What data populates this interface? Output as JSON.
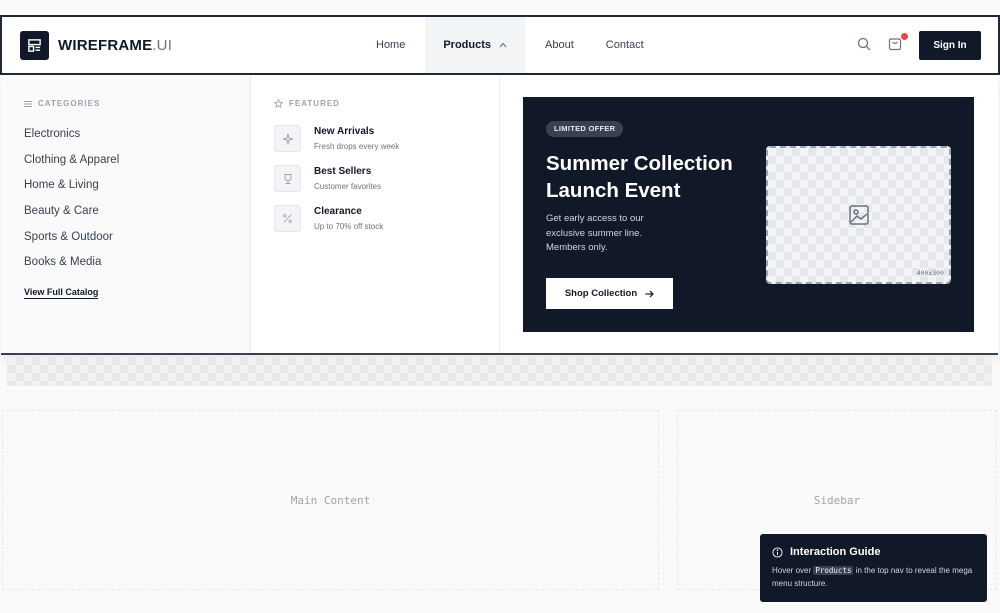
{
  "brand": {
    "name_bold": "WIREFRAME",
    "name_light": ".UI",
    "icon": "layout-icon"
  },
  "nav": {
    "items": [
      {
        "label": "Home"
      },
      {
        "label": "Products",
        "active": true
      },
      {
        "label": "About"
      },
      {
        "label": "Contact"
      }
    ],
    "signin_label": "Sign In",
    "cart_has_notification": true
  },
  "mega": {
    "categories_title": "CATEGORIES",
    "categories": [
      "Electronics",
      "Clothing & Apparel",
      "Home & Living",
      "Beauty & Care",
      "Sports & Outdoor",
      "Books & Media"
    ],
    "view_all_label": "View Full Catalog",
    "featured_title": "FEATURED",
    "featured": [
      {
        "title": "New Arrivals",
        "subtitle": "Fresh drops every week",
        "icon": "sparkle-icon"
      },
      {
        "title": "Best Sellers",
        "subtitle": "Customer favorites",
        "icon": "trophy-icon"
      },
      {
        "title": "Clearance",
        "subtitle": "Up to 70% off stock",
        "icon": "percent-icon"
      }
    ],
    "promo": {
      "badge": "LIMITED OFFER",
      "title": "Summer Collection Launch Event",
      "description": "Get early access to our exclusive summer line. Members only.",
      "button_label": "Shop Collection",
      "image_placeholder": "400x300"
    }
  },
  "page": {
    "main_label": "Main Content",
    "sidebar_label": "Sidebar"
  },
  "guide": {
    "title": "Interaction Guide",
    "text_before": "Hover over ",
    "code": "Products",
    "text_after": " in the top nav to reveal the mega menu structure."
  },
  "colors": {
    "primary_dark": "#111827",
    "accent_notification": "#ef4444",
    "surface": "#ffffff",
    "muted_text": "#9ca3af"
  }
}
